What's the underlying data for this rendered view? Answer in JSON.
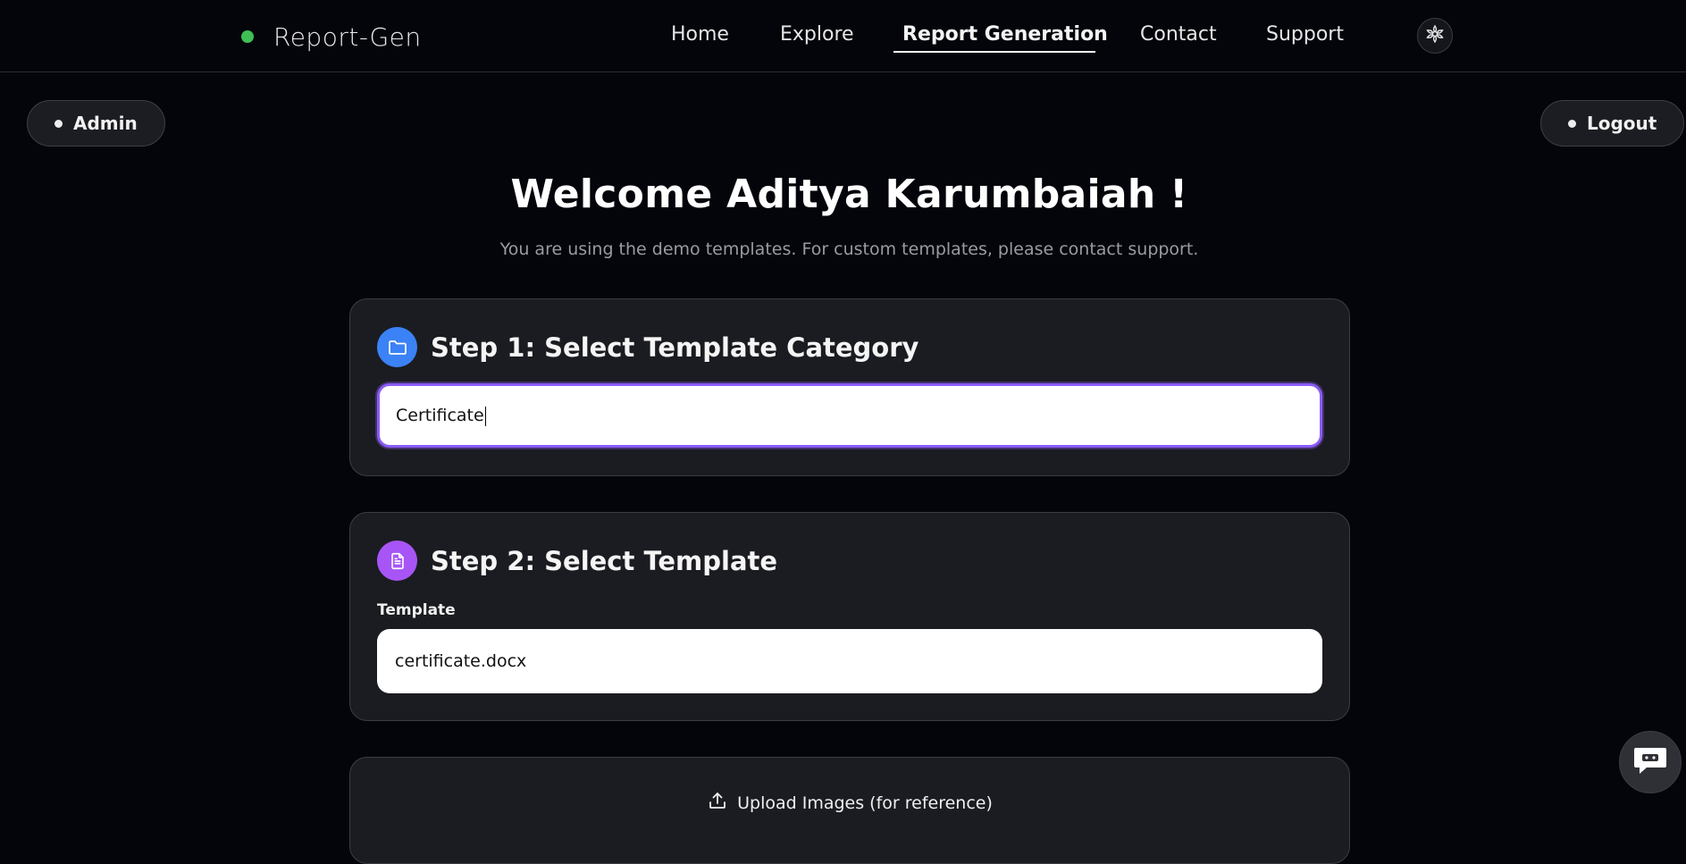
{
  "brand": {
    "name": "Report-Gen",
    "status_color": "#3fbf56"
  },
  "nav": {
    "items": [
      {
        "label": "Home"
      },
      {
        "label": "Explore"
      },
      {
        "label": "Report Generation",
        "active": true
      },
      {
        "label": "Contact"
      },
      {
        "label": "Support"
      }
    ],
    "theme_icon": "flower-icon"
  },
  "admin_button": {
    "label": "Admin"
  },
  "logout_button": {
    "label": "Logout"
  },
  "welcome": {
    "title": "Welcome Aditya Karumbaiah !",
    "subtitle": "You are using the demo templates. For custom templates, please contact support."
  },
  "step1": {
    "title": "Step 1: Select Template Category",
    "icon": "folder-icon",
    "icon_color": "#3b82f6",
    "input_value": "Certificate"
  },
  "step2": {
    "title": "Step 2: Select Template",
    "icon": "document-icon",
    "icon_color": "#a855f7",
    "field_label": "Template",
    "selected_value": "certificate.docx"
  },
  "upload": {
    "label": "Upload Images (for reference)",
    "icon": "upload-icon"
  },
  "chat": {
    "icon": "chat-icon"
  },
  "colors": {
    "accent_focus": "#8b5cf6",
    "background": "#04050b",
    "card": "#1b1c21"
  }
}
